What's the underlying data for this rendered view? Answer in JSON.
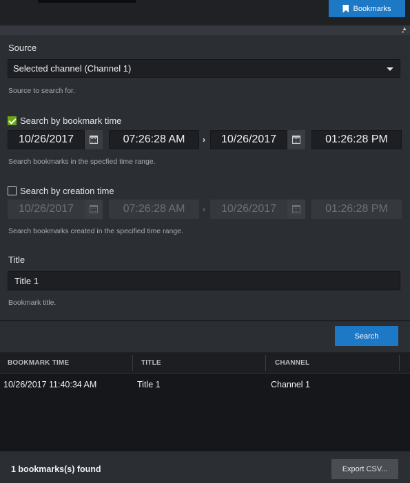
{
  "header": {
    "bookmarks_button": "Bookmarks"
  },
  "source": {
    "label": "Source",
    "selected": "Selected channel (Channel 1)",
    "hint": "Source to search for."
  },
  "bookmark_time": {
    "checked": true,
    "label": "Search by bookmark time",
    "start_date": "10/26/2017",
    "start_time": "07:26:28 AM",
    "end_date": "10/26/2017",
    "end_time": "01:26:28 PM",
    "hint": "Search bookmarks in the specfied time range."
  },
  "creation_time": {
    "checked": false,
    "label": "Search by creation time",
    "start_date": "10/26/2017",
    "start_time": "07:26:28 AM",
    "end_date": "10/26/2017",
    "end_time": "01:26:28 PM",
    "hint": "Search bookmarks created in the specified time range."
  },
  "title": {
    "label": "Title",
    "value": "Title 1",
    "hint": "Bookmark title."
  },
  "search_button": "Search",
  "table": {
    "columns": [
      "BOOKMARK TIME",
      "TITLE",
      "CHANNEL"
    ],
    "rows": [
      [
        "10/26/2017 11:40:34 AM",
        "Title 1",
        "Channel 1"
      ]
    ]
  },
  "footer": {
    "count_text": "1 bookmarks(s) found",
    "export_button": "Export CSV..."
  },
  "colors": {
    "accent": "#1d78c6",
    "check": "#6aa618",
    "panel": "#2b2e33"
  }
}
